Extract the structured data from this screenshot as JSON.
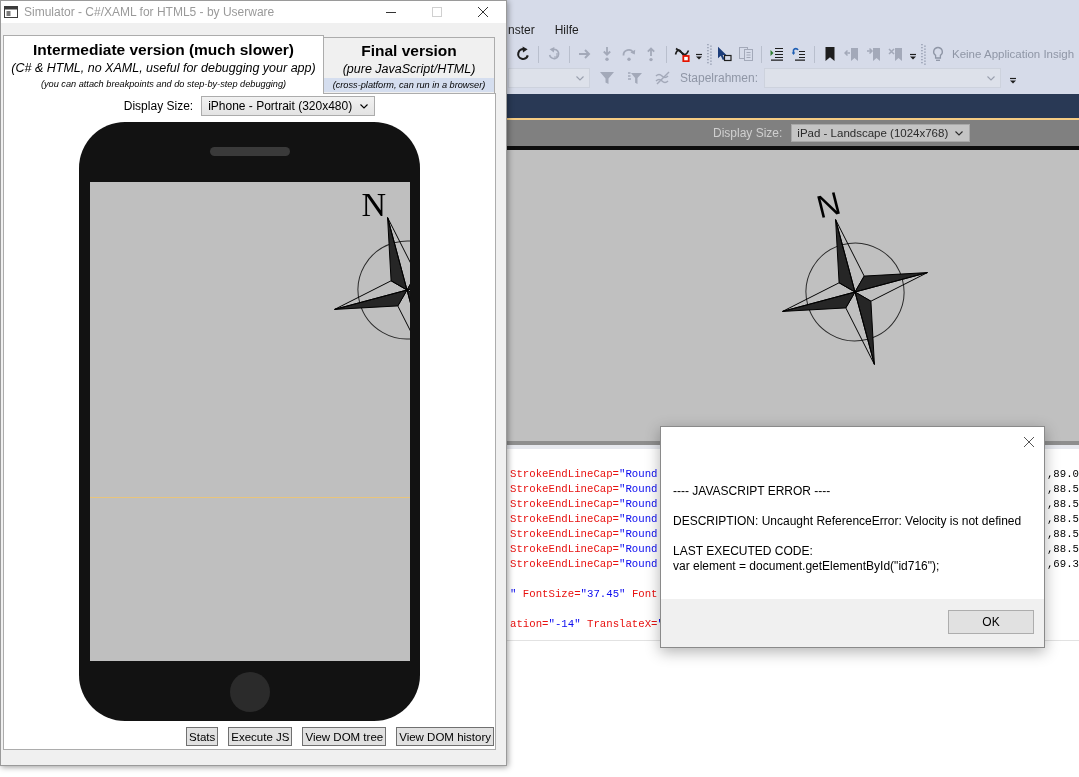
{
  "simulator": {
    "title": "Simulator - C#/XAML for HTML5 - by Userware",
    "maximize_disabled": true,
    "tabs": [
      {
        "title": "Intermediate version (much slower)",
        "subtitle": "(C# & HTML, no XAML, useful for debugging your app)",
        "note": "(you can attach breakpoints and do step-by-step debugging)",
        "selected": true
      },
      {
        "title": "Final version",
        "subtitle": "(pure JavaScript/HTML)",
        "note": "(cross-platform, can run in a browser)",
        "selected": false
      }
    ],
    "display_size_label": "Display Size:",
    "display_size": "iPhone - Portrait (320x480)",
    "compass_label": "N",
    "buttons": [
      {
        "label": "Stats"
      },
      {
        "label": "Execute JS"
      },
      {
        "label": "View DOM tree"
      },
      {
        "label": "View DOM history"
      }
    ]
  },
  "ide": {
    "menu": [
      {
        "label": "nster"
      },
      {
        "label": "Hilfe"
      }
    ],
    "toolbar_1": [
      {
        "kind": "restart",
        "disabled": false
      },
      {
        "kind": "separator"
      },
      {
        "kind": "step-back",
        "disabled": true
      },
      {
        "kind": "separator"
      },
      {
        "kind": "show-next",
        "disabled": true
      },
      {
        "kind": "step-into",
        "disabled": true
      },
      {
        "kind": "step-over",
        "disabled": true
      },
      {
        "kind": "step-out",
        "disabled": true
      },
      {
        "kind": "separator"
      },
      {
        "kind": "breakpoints",
        "disabled": false
      },
      {
        "kind": "overflow"
      },
      {
        "kind": "grip"
      },
      {
        "kind": "pointer",
        "disabled": false
      },
      {
        "kind": "pages",
        "disabled": true
      },
      {
        "kind": "separator"
      },
      {
        "kind": "indent",
        "disabled": false
      },
      {
        "kind": "outdent",
        "disabled": false
      },
      {
        "kind": "separator"
      },
      {
        "kind": "bookmark",
        "disabled": false
      },
      {
        "kind": "bookmark-prev",
        "disabled": true
      },
      {
        "kind": "bookmark-next",
        "disabled": true
      },
      {
        "kind": "bookmark-clear",
        "disabled": true
      },
      {
        "kind": "overflow"
      },
      {
        "kind": "grip"
      },
      {
        "kind": "insights",
        "disabled": true,
        "label": "Keine Application Insigh"
      }
    ],
    "toolbar_2": [
      {
        "kind": "combo",
        "disabled": true
      },
      {
        "kind": "filter",
        "disabled": true
      },
      {
        "kind": "filter-clear",
        "disabled": true
      },
      {
        "kind": "threads",
        "disabled": true
      },
      {
        "kind": "label",
        "text": "Stapelrahmen:",
        "disabled": true
      },
      {
        "kind": "combo",
        "disabled": true
      },
      {
        "kind": "overflow"
      }
    ],
    "preview": {
      "display_size_label": "Display Size:",
      "display_size": "iPad - Landscape (1024x768)",
      "compass_label": "N"
    },
    "code_blocks": [
      {
        "lines": [
          {
            "tokens": [
              {
                "kind": "attr",
                "text": "StrokeEndLineCap="
              },
              {
                "kind": "value",
                "text": "\"Round"
              }
            ],
            "tail": ",89.0"
          },
          {
            "tokens": [
              {
                "kind": "attr",
                "text": "StrokeEndLineCap="
              },
              {
                "kind": "value",
                "text": "\"Round"
              }
            ],
            "tail": ",88.5"
          },
          {
            "tokens": [
              {
                "kind": "attr",
                "text": "StrokeEndLineCap="
              },
              {
                "kind": "value",
                "text": "\"Round"
              }
            ],
            "tail": ",88.5"
          },
          {
            "tokens": [
              {
                "kind": "attr",
                "text": "StrokeEndLineCap="
              },
              {
                "kind": "value",
                "text": "\"Round"
              }
            ],
            "tail": ",88.5"
          },
          {
            "tokens": [
              {
                "kind": "attr",
                "text": "StrokeEndLineCap="
              },
              {
                "kind": "value",
                "text": "\"Round"
              }
            ],
            "tail": ",88.5"
          },
          {
            "tokens": [
              {
                "kind": "attr",
                "text": "StrokeEndLineCap="
              },
              {
                "kind": "value",
                "text": "\"Round"
              }
            ],
            "tail": ",88.5"
          },
          {
            "tokens": [
              {
                "kind": "attr",
                "text": "StrokeEndLineCap="
              },
              {
                "kind": "value",
                "text": "\"Round"
              }
            ],
            "tail": ",69.3"
          }
        ]
      },
      {
        "lines": [
          {
            "tokens": [
              {
                "kind": "value",
                "text": "\""
              },
              {
                "kind": "attr",
                "text": " FontSize="
              },
              {
                "kind": "value",
                "text": "\"37.45\""
              },
              {
                "kind": "attr",
                "text": " Font"
              }
            ]
          }
        ]
      },
      {
        "lines": [
          {
            "tokens": [
              {
                "kind": "attr",
                "text": "ation="
              },
              {
                "kind": "value",
                "text": "\"-14\""
              },
              {
                "kind": "attr",
                "text": " TranslateX="
              },
              {
                "kind": "value",
                "text": "\""
              }
            ]
          }
        ]
      }
    ]
  },
  "dialog": {
    "paragraphs": [
      [
        "---- JAVASCRIPT ERROR ----"
      ],
      [
        "DESCRIPTION: Uncaught ReferenceError: Velocity is not defined"
      ],
      [
        "LAST EXECUTED CODE:",
        "var element = document.getElementById(\"id716\");"
      ]
    ],
    "button": "OK"
  }
}
